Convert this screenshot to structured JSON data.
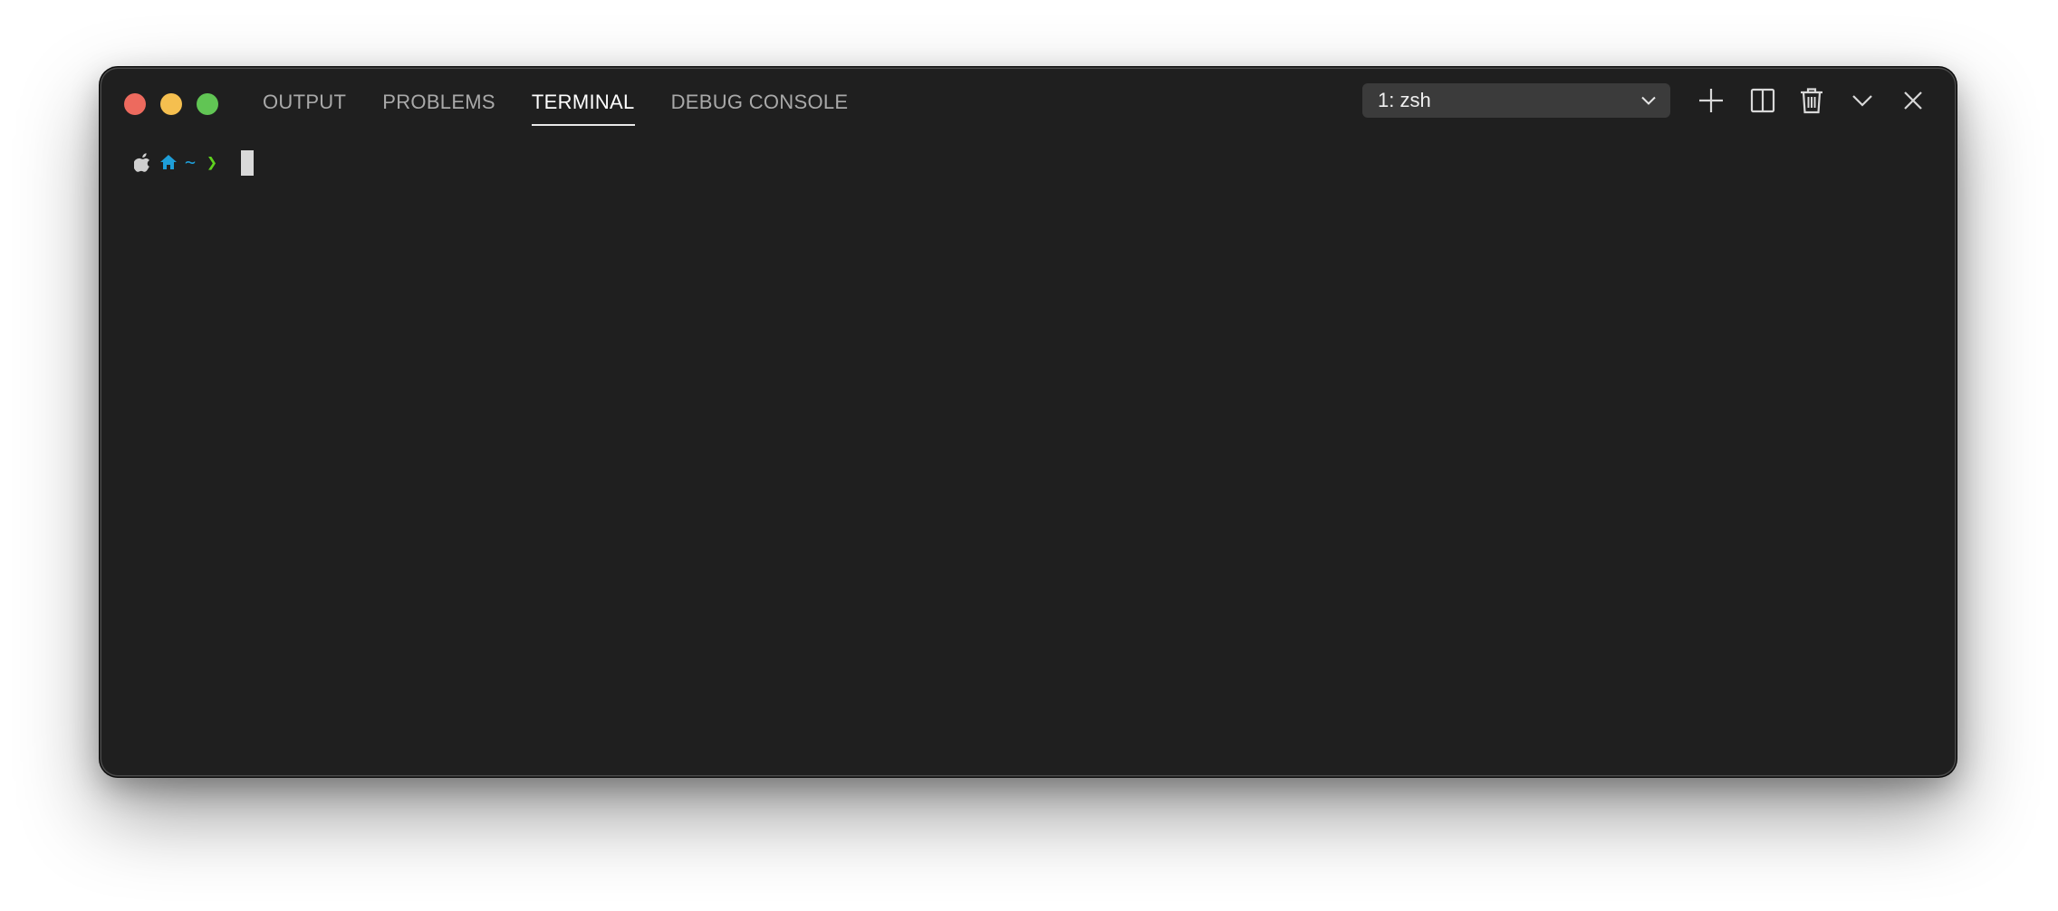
{
  "colors": {
    "window_bg": "#1f1f1f",
    "traffic_close": "#ed6a5e",
    "traffic_minimize": "#f5bf4f",
    "traffic_maximize": "#61c554",
    "tab_inactive": "#a9a9a9",
    "tab_active": "#ffffff",
    "prompt_apple": "#d0d0d0",
    "prompt_home": "#1e9ed8",
    "prompt_tilde": "#1e9ed8",
    "prompt_arrow": "#5fd21e"
  },
  "tabs": [
    {
      "label": "OUTPUT",
      "active": false
    },
    {
      "label": "PROBLEMS",
      "active": false
    },
    {
      "label": "TERMINAL",
      "active": true
    },
    {
      "label": "DEBUG CONSOLE",
      "active": false
    }
  ],
  "terminal_selector": {
    "selected": "1: zsh",
    "icon": "chevron-down-icon"
  },
  "actions": [
    {
      "name": "new-terminal",
      "icon": "plus-icon"
    },
    {
      "name": "split-terminal",
      "icon": "split-icon"
    },
    {
      "name": "kill-terminal",
      "icon": "trash-icon"
    },
    {
      "name": "maximize-panel",
      "icon": "chevron-down-icon"
    },
    {
      "name": "close-panel",
      "icon": "close-icon"
    }
  ],
  "prompt": {
    "icons": [
      "apple-icon",
      "home-icon"
    ],
    "directory": "~",
    "arrow": "❯"
  }
}
